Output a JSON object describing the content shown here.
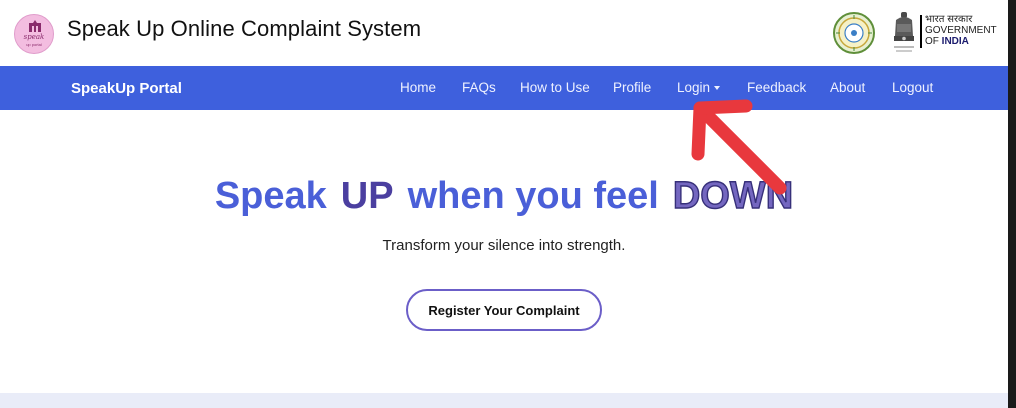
{
  "header": {
    "title": "Speak Up Online Complaint System",
    "logo_text": "speak",
    "logo_subtext": "up portal",
    "gov_hindi": "भारत सरकार",
    "gov_line1": "GOVERNMENT",
    "gov_line2_prefix": "OF ",
    "gov_line2_bold": "INDIA"
  },
  "nav": {
    "brand": "SpeakUp Portal",
    "items": [
      {
        "label": "Home"
      },
      {
        "label": "FAQs"
      },
      {
        "label": "How to Use"
      },
      {
        "label": "Profile"
      },
      {
        "label": "Login"
      },
      {
        "label": "Feedback"
      },
      {
        "label": "About"
      },
      {
        "label": "Logout"
      }
    ]
  },
  "hero": {
    "title_part1": "Speak",
    "title_part2": "UP",
    "title_part3": "when you feel",
    "title_part4": "DOWN",
    "tagline": "Transform your silence into strength.",
    "cta_label": "Register Your Complaint"
  },
  "colors": {
    "navbar": "#3e60dd",
    "hero_primary": "#4a5fd8",
    "hero_accent": "#4b3fa0",
    "annotation_arrow": "#e8383d"
  },
  "icons": {
    "logo": "speakup-logo-icon",
    "ap_emblem": "andhra-pradesh-emblem-icon",
    "india_emblem": "ashoka-emblem-icon",
    "dropdown": "caret-down-icon",
    "annotation": "red-arrow-icon"
  }
}
